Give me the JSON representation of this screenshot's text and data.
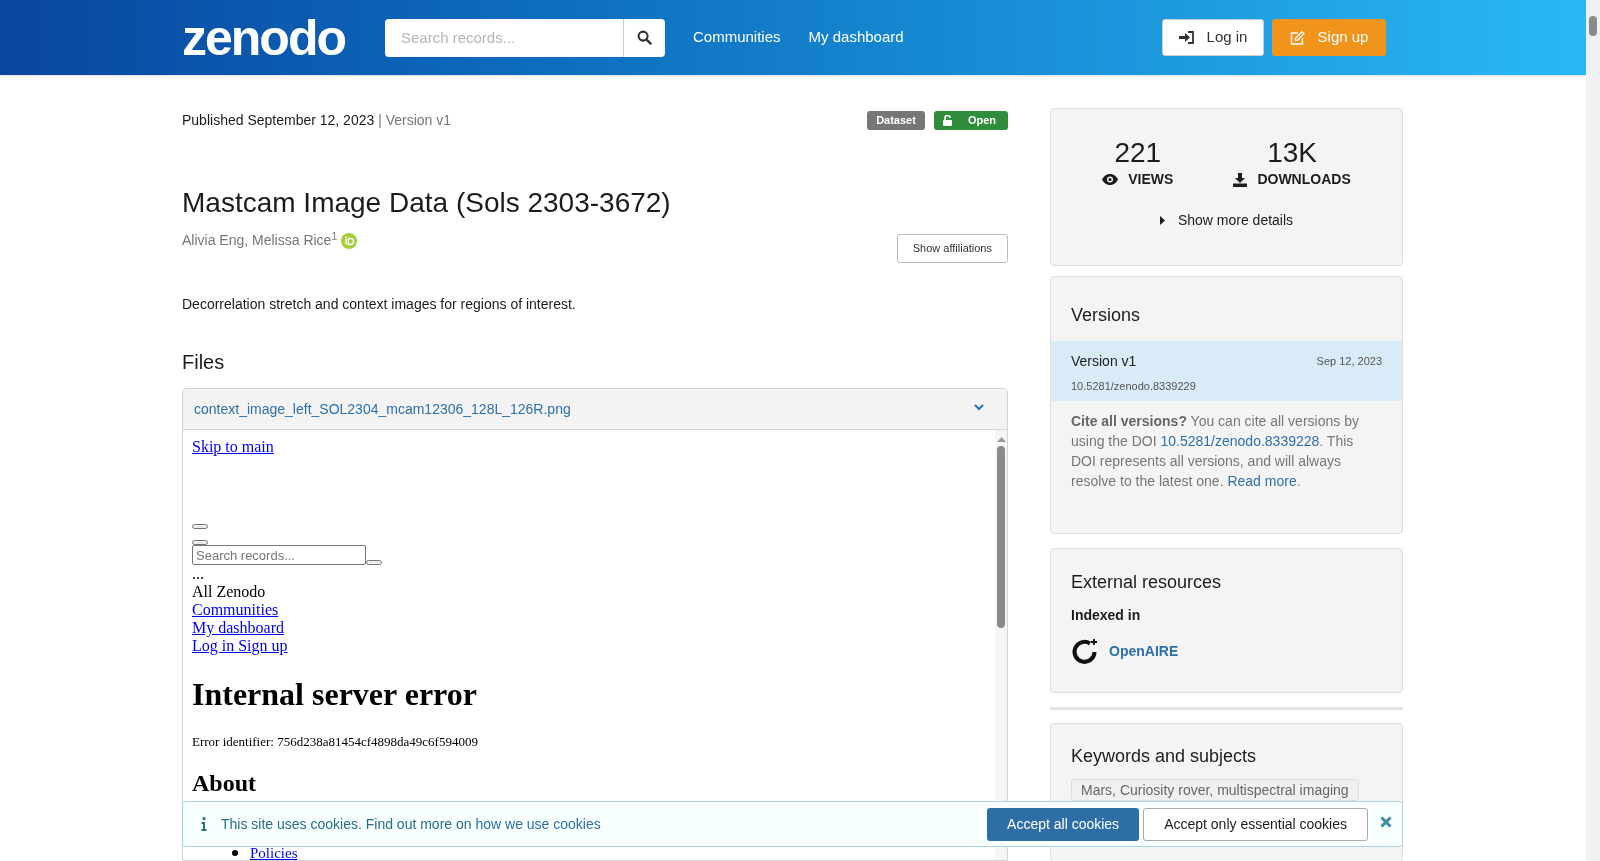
{
  "header": {
    "logo": "zenodo",
    "search": {
      "placeholder": "Search records..."
    },
    "nav": [
      "Communities",
      "My dashboard"
    ],
    "buttons": [
      {
        "label": "Log in",
        "kind": "login"
      },
      {
        "label": "Sign up",
        "kind": "signup"
      }
    ]
  },
  "record": {
    "published": "Published September 12, 2023",
    "version": "| Version v1",
    "badges": [
      {
        "label": "Dataset",
        "kind": "type"
      },
      {
        "label": "Open",
        "kind": "access"
      }
    ],
    "title": "Mastcam Image Data (Sols 2303-3672)",
    "authors": "Alivia Eng, Melissa Rice$^{1}$",
    "show_affiliations": "Show affiliations",
    "description": "Decorrelation stretch and context images for regions of interest."
  },
  "files": {
    "heading": "Files",
    "file_name": "context_image_left_SOL2304_mcam12306_128L_126R.png",
    "preview": {
      "skip_link": "Skip to main",
      "search_placeholder": "Search records...",
      "ellipsis": "...",
      "menu_label": "All Zenodo",
      "links": [
        "Communities",
        "My dashboard",
        "Log in Sign up"
      ],
      "error_title": "Internal server error",
      "error_identifier": "Error identifier: 756d238a81454cf4898da49c6f594009",
      "about_heading": "About",
      "about_links": [
        "Policies"
      ]
    }
  },
  "stats": {
    "items": [
      {
        "value": "221",
        "label": "VIEWS",
        "kind": "views"
      },
      {
        "value": "13K",
        "label": "DOWNLOADS",
        "kind": "downloads"
      }
    ],
    "details_toggle": "Show more details"
  },
  "versions": {
    "heading": "Versions",
    "items": [
      {
        "label": "Version v1",
        "date": "Sep 12, 2023",
        "doi": "10.5281/zenodo.8339229",
        "selected": true
      }
    ],
    "cite": {
      "text": "**Cite all versions?** You can cite all versions by using the DOI ",
      "doi": "10.5281/zenodo.8339228",
      "text2": ". This DOI represents all versions, and will always resolve to the latest one. ",
      "read_more": "Read more",
      "end": "."
    }
  },
  "external": {
    "heading": "External resources",
    "subheading": "Indexed in",
    "items": [
      {
        "label": "OpenAIRE"
      }
    ]
  },
  "keywords": {
    "heading": "Keywords and subjects",
    "tags": [
      "Mars, Curiosity rover, multispectral imaging"
    ]
  },
  "cookie": {
    "text": "This site uses cookies. Find out more on ",
    "link": "how we use cookies",
    "buttons": [
      {
        "label": "Accept all cookies",
        "kind": "primary"
      },
      {
        "label": "Accept only essential cookies",
        "kind": "secondary"
      }
    ]
  }
}
